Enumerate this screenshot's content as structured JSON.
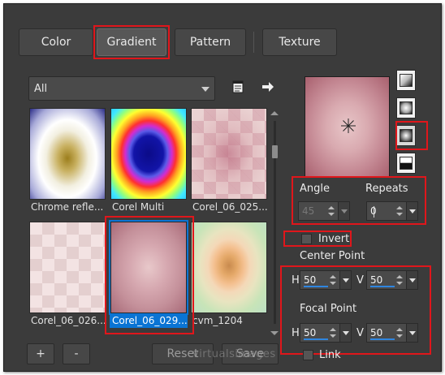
{
  "tabs": [
    "Color",
    "Gradient",
    "Pattern",
    "Texture"
  ],
  "preset_dropdown": {
    "selected": "All"
  },
  "icons": {
    "preset_manager": "document-list-icon",
    "apply_arrow": "right-arrow-icon",
    "style_linear": "linear-style-icon",
    "style_rectangular": "rectangular-style-icon",
    "style_sunburst": "sunburst-style-icon",
    "style_radial": "radial-style-icon",
    "center_marker": "asterisk-icon"
  },
  "gradients": [
    {
      "name": "Chrome refle..."
    },
    {
      "name": "Corel Multi"
    },
    {
      "name": "Corel_06_025..."
    },
    {
      "name": "Corel_06_026..."
    },
    {
      "name": "Corel_06_029...",
      "selected": true
    },
    {
      "name": "cvm_1204"
    }
  ],
  "buttons": {
    "add": "+",
    "remove": "-",
    "reset": "Reset",
    "save": "Save"
  },
  "angle": {
    "label": "Angle",
    "value": "45"
  },
  "repeats": {
    "label": "Repeats",
    "value": "0"
  },
  "invert": {
    "label": "Invert",
    "checked": false
  },
  "center_point": {
    "label": "Center Point",
    "h_label": "H",
    "h_value": "50",
    "v_label": "V",
    "v_value": "50"
  },
  "focal_point": {
    "label": "Focal Point",
    "h_label": "H",
    "h_value": "50",
    "v_label": "V",
    "v_value": "50"
  },
  "link": {
    "label": "Link",
    "checked": false
  },
  "watermark": "virtualsimages",
  "colors": {
    "annotation_red": "#e0161b",
    "selection_blue": "#0a74d4",
    "background": "#3b3b3b"
  }
}
